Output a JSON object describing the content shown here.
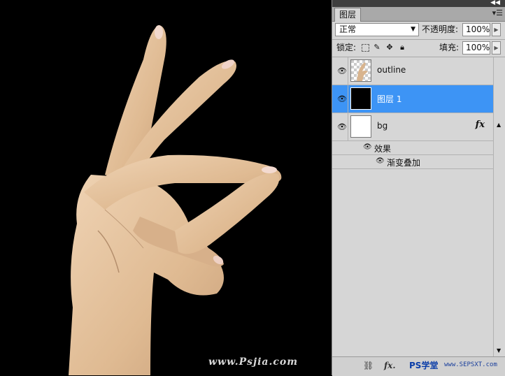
{
  "canvas": {
    "watermark": "www.Psjia.com"
  },
  "panel": {
    "tab_label": "图层",
    "menu_icon": "panel-menu-icon",
    "blend_mode": "正常",
    "opacity_label": "不透明度:",
    "opacity_value": "100%",
    "lock_label": "锁定:",
    "fill_label": "填充:",
    "fill_value": "100%",
    "layers": [
      {
        "name": "outline",
        "selected": false,
        "visible": true
      },
      {
        "name": "图层 1",
        "selected": true,
        "visible": true
      },
      {
        "name": "bg",
        "selected": false,
        "visible": true,
        "fx": "fx"
      }
    ],
    "effects_label": "效果",
    "effect_item": "渐变叠加",
    "bottom": {
      "link_icon": "link-icon",
      "fx_label": "fx.",
      "watermark_ps": "PS学堂",
      "watermark_url": "www.SEPSXT.com"
    }
  },
  "colors": {
    "selection": "#3d94f5",
    "panel_bg": "#d6d6d6",
    "canvas_bg": "#000000"
  }
}
